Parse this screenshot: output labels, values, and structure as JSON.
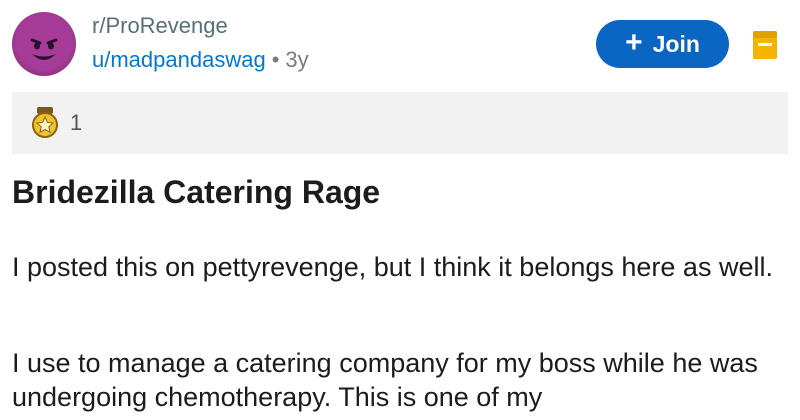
{
  "header": {
    "subreddit": "r/ProRevenge",
    "username": "u/madpandaswag",
    "separator": "•",
    "age": "3y",
    "join_icon": "+",
    "join_label": "Join",
    "avatar_icon": "devil-emoji-icon",
    "save_icon": "bookmark-icon"
  },
  "awards": {
    "icon": "award-medal-icon",
    "count": "1"
  },
  "post": {
    "title": "Bridezilla Catering Rage",
    "paragraph1": "I posted this on pettyrevenge, but I think it belongs here as well.",
    "paragraph2": "I use to manage a catering company for my boss while he was undergoing chemotherapy. This is one of my"
  },
  "colors": {
    "join_button": "#0a66c2",
    "username": "#0079d3",
    "award_bar": "#f2f2f2",
    "avatar": "#a63c97",
    "save_icon": "#f4b400"
  }
}
